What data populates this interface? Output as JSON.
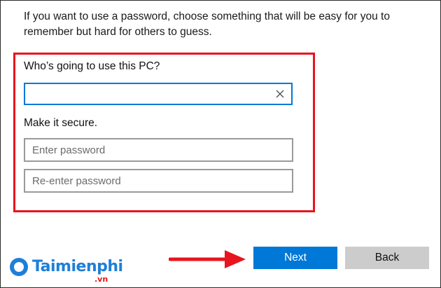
{
  "intro_text": "If you want to use a password, choose something that will be easy for you to remember but hard for others to guess.",
  "form": {
    "who_label": "Who’s going to use this PC?",
    "name_value": "",
    "secure_label": "Make it secure.",
    "password_placeholder": "Enter password",
    "reenter_placeholder": "Re-enter password"
  },
  "buttons": {
    "next_label": "Next",
    "back_label": "Back"
  },
  "watermark": {
    "brand": "Taimienphi",
    "suffix": ".vn"
  },
  "colors": {
    "accent": "#0078d7",
    "highlight": "#e8141e",
    "back_button": "#cccccc"
  },
  "icons": {
    "clear": "close-icon",
    "arrow": "arrow-right-icon"
  }
}
